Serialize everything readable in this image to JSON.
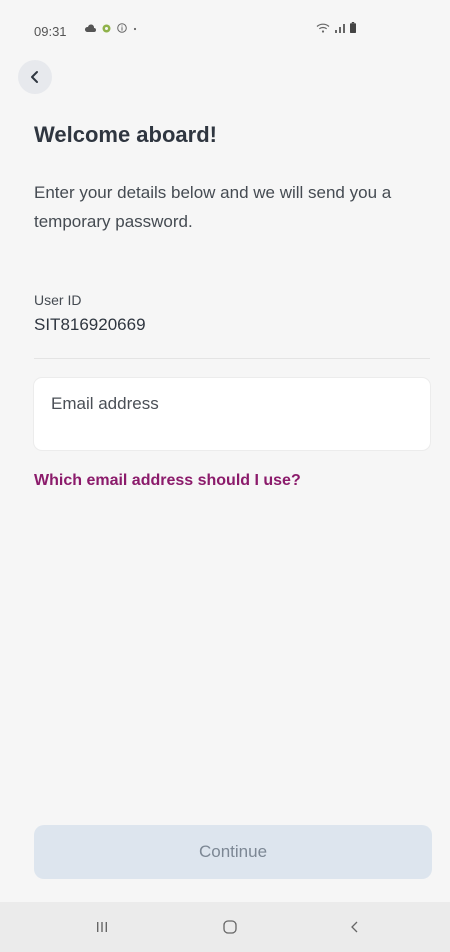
{
  "status_bar": {
    "time": "09:31",
    "left_icons": [
      "cloud-icon",
      "settings-dot-icon",
      "info-icon",
      "dot-icon"
    ],
    "right_icons": [
      "wifi-icon",
      "signal-icon",
      "battery-icon"
    ]
  },
  "header": {
    "back_icon": "chevron-left-icon"
  },
  "main": {
    "title": "Welcome aboard!",
    "subtitle": "Enter your details below and we will send you a temporary password.",
    "user_id_label": "User ID",
    "user_id_value": "SIT816920669",
    "email_placeholder": "Email address",
    "help_link": "Which email address should I use?"
  },
  "footer": {
    "continue_label": "Continue"
  },
  "nav_bar": {
    "items": [
      "recent-apps-icon",
      "home-icon",
      "back-icon"
    ]
  },
  "colors": {
    "background": "#f6f6f6",
    "link": "#8b1b6b",
    "button_disabled_bg": "#dde5ee",
    "button_disabled_text": "#7c8794"
  }
}
